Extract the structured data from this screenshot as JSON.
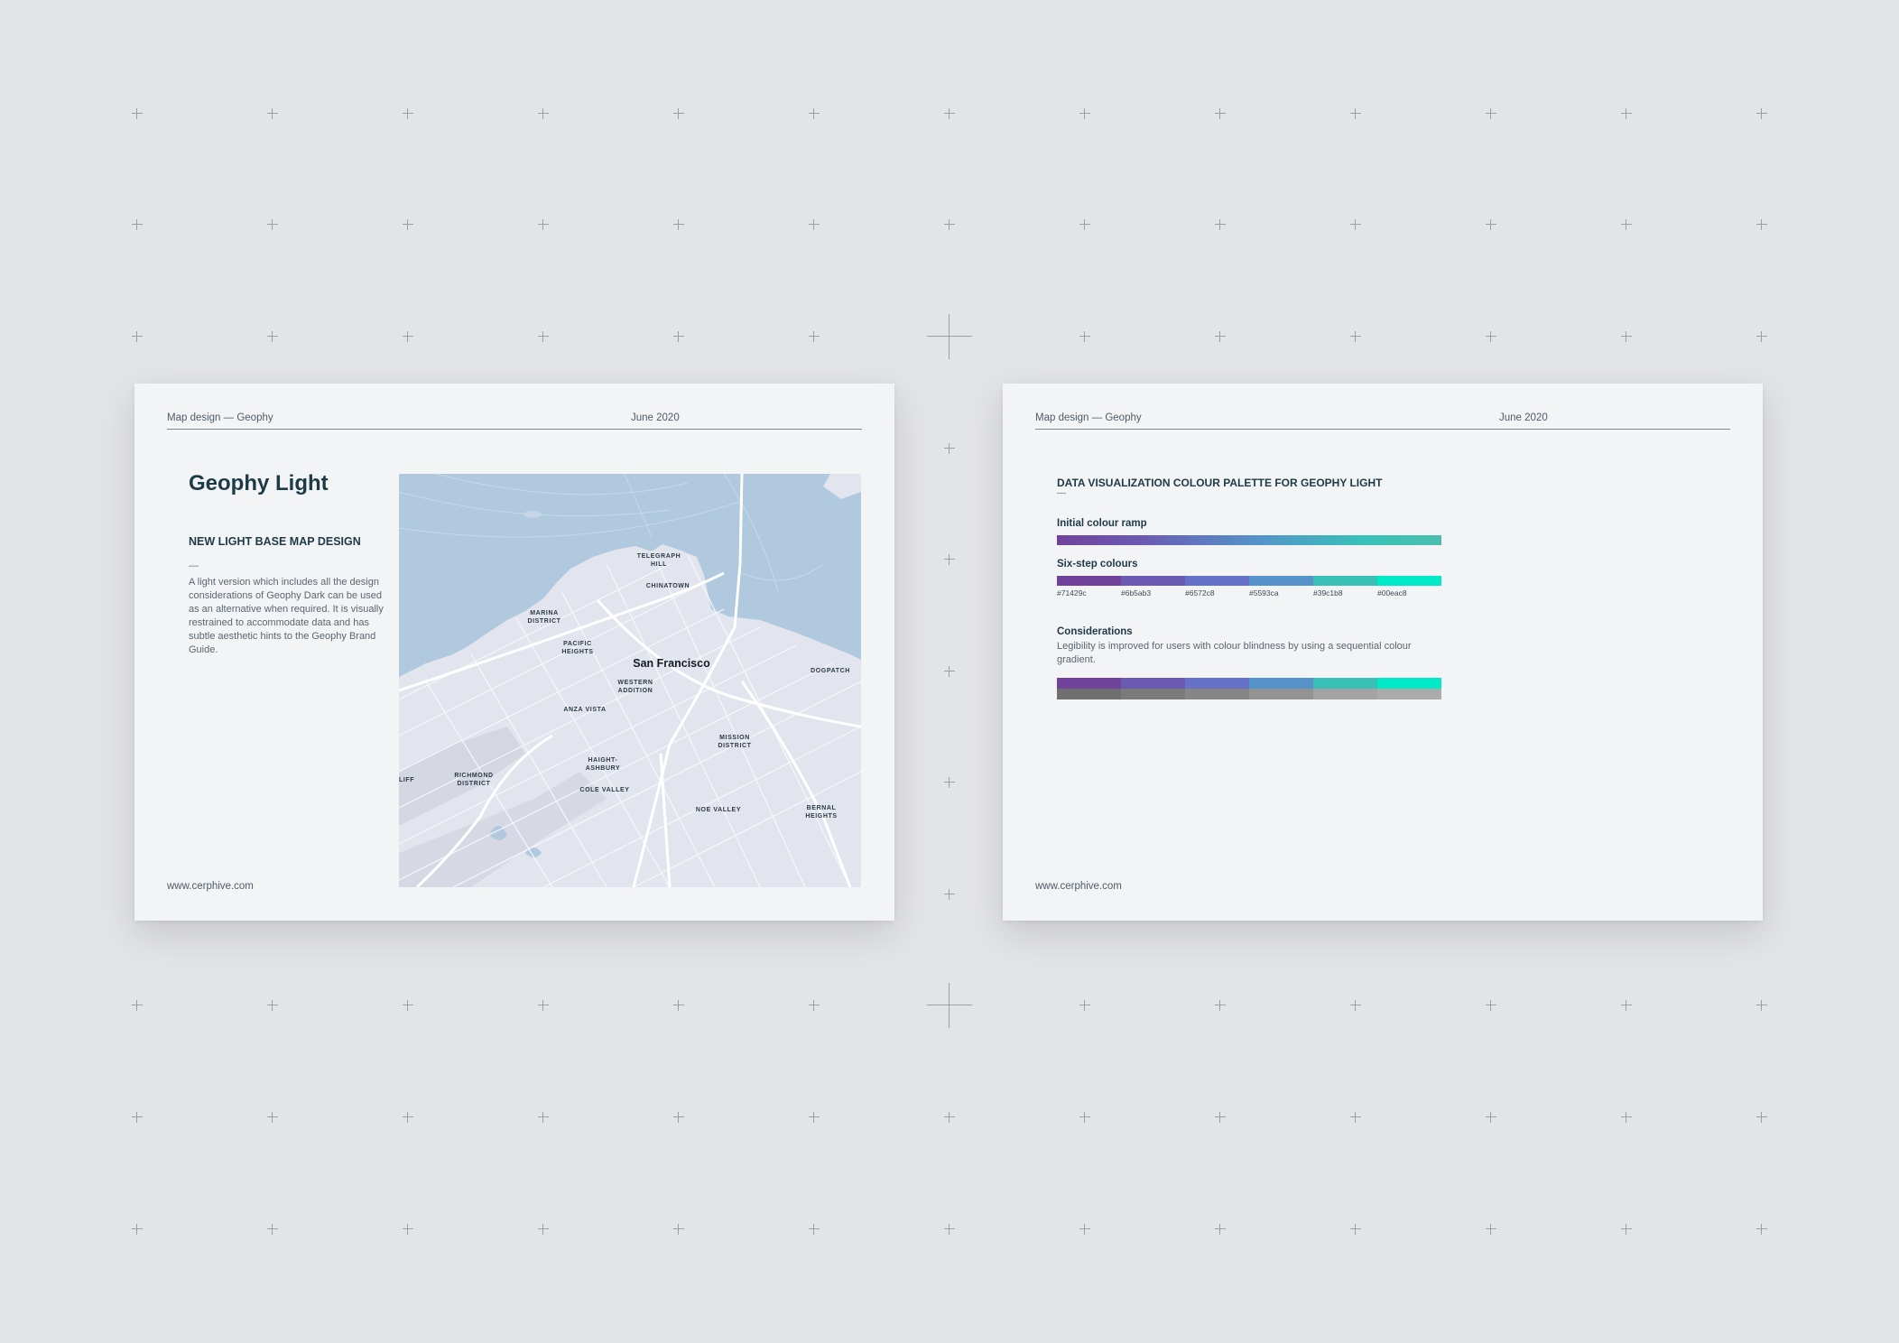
{
  "left_page": {
    "header_left": "Map design — Geophy",
    "header_right": "June 2020",
    "title": "Geophy Light",
    "subtitle": "NEW LIGHT BASE MAP DESIGN",
    "dash": "—",
    "description": "A light version which includes all the design considerations of Geophy Dark can be used as an alternative when required. It is visually restrained to accommodate data and has subtle aesthetic hints to the Geophy Brand Guide.",
    "footer": "www.cerphive.com"
  },
  "map": {
    "city": "San Francisco",
    "water_color": "#b0c9df",
    "land_color": "#e2e5ed",
    "labels": {
      "telegraph_hill_1": "TELEGRAPH",
      "telegraph_hill_2": "HILL",
      "chinatown": "CHINATOWN",
      "marina_1": "MARINA",
      "marina_2": "DISTRICT",
      "pacific_1": "PACIFIC",
      "pacific_2": "HEIGHTS",
      "dogpatch": "DOGPATCH",
      "western_1": "WESTERN",
      "western_2": "ADDITION",
      "anza": "ANZA VISTA",
      "mission_1": "MISSION",
      "mission_2": "DISTRICT",
      "cliff": "LIFF",
      "richmond_1": "RICHMOND",
      "richmond_2": "DISTRICT",
      "haight_1": "HAIGHT-",
      "haight_2": "ASHBURY",
      "cole": "COLE VALLEY",
      "noe": "NOE VALLEY",
      "bernal_1": "BERNAL",
      "bernal_2": "HEIGHTS"
    }
  },
  "right_page": {
    "header_left": "Map design — Geophy",
    "header_right": "June 2020",
    "title": "DATA VISUALIZATION COLOUR PALETTE FOR GEOPHY LIGHT",
    "dash": "—",
    "ramp_label": "Initial colour ramp",
    "six_step_label": "Six-step colours",
    "six_step": [
      {
        "hex": "#71429c",
        "label": "#71429c"
      },
      {
        "hex": "#6b5ab3",
        "label": "#6b5ab3"
      },
      {
        "hex": "#6572c8",
        "label": "#6572c8"
      },
      {
        "hex": "#5593ca",
        "label": "#5593ca"
      },
      {
        "hex": "#39c1b8",
        "label": "#39c1b8"
      },
      {
        "hex": "#00eac8",
        "label": "#00eac8"
      }
    ],
    "grayscale": [
      "#6f6f6f",
      "#7b7b7b",
      "#868686",
      "#939393",
      "#a3a3a3",
      "#ababab"
    ],
    "considerations_label": "Considerations",
    "considerations_text": "Legibility is improved for users with colour blindness by using a sequential colour gradient.",
    "footer": "www.cerphive.com"
  }
}
